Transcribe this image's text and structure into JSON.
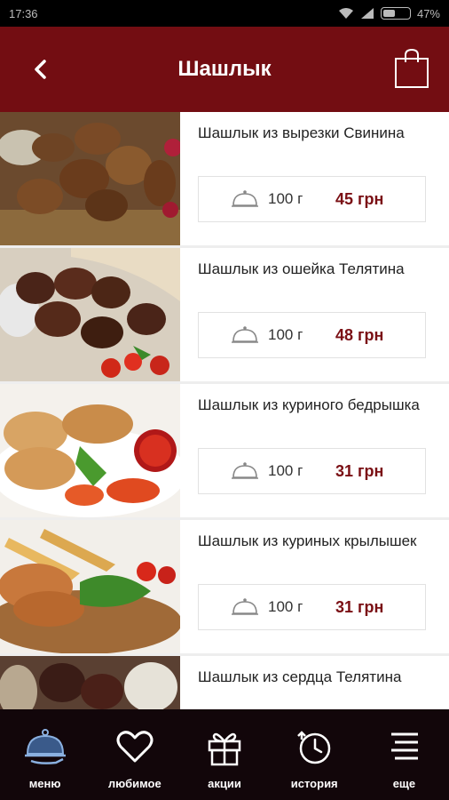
{
  "status_bar": {
    "time": "17:36",
    "battery_percent": "47%",
    "battery_level": 0.47
  },
  "header": {
    "title": "Шашлык"
  },
  "items": [
    {
      "name": "Шашлык из вырезки Свинина",
      "weight": "100 г",
      "price": "45 грн"
    },
    {
      "name": "Шашлык из ошейка Телятина",
      "weight": "100 г",
      "price": "48 грн"
    },
    {
      "name": "Шашлык из куриного бедрышка",
      "weight": "100 г",
      "price": "31 грн"
    },
    {
      "name": "Шашлык из куриных крылышек",
      "weight": "100 г",
      "price": "31 грн"
    },
    {
      "name": "Шашлык из сердца Телятина",
      "weight": "",
      "price": ""
    }
  ],
  "nav": [
    {
      "label": "меню",
      "icon": "cloche-icon"
    },
    {
      "label": "любимое",
      "icon": "heart-icon"
    },
    {
      "label": "акции",
      "icon": "gift-icon"
    },
    {
      "label": "история",
      "icon": "history-icon"
    },
    {
      "label": "еще",
      "icon": "menu-lines-icon"
    }
  ],
  "colors": {
    "brand": "#730d12",
    "price": "#7a0f14",
    "nav_bg": "#12060a"
  }
}
